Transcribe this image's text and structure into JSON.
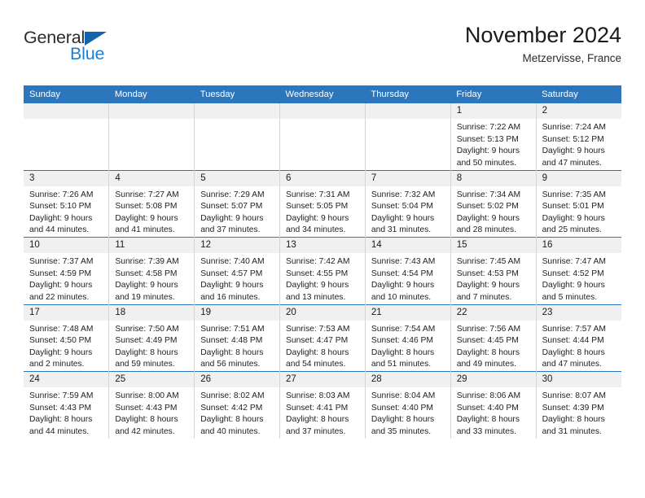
{
  "brand": {
    "name_part1": "General",
    "name_part2": "Blue",
    "triangle_icon": "triangle-icon",
    "accent_color": "#1d7fd4",
    "triangle_color": "#1464ad"
  },
  "header": {
    "title": "November 2024",
    "subtitle": "Metzervisse, France"
  },
  "theme": {
    "header_bg": "#2c76bd",
    "daynum_bg": "#f0f0f0",
    "cell_border": "#d4d4d4",
    "row_border": "#2c76bd"
  },
  "weekdays": [
    "Sunday",
    "Monday",
    "Tuesday",
    "Wednesday",
    "Thursday",
    "Friday",
    "Saturday"
  ],
  "weeks": [
    [
      {
        "day": "",
        "sunrise": "",
        "sunset": "",
        "daylight_line1": "",
        "daylight_line2": ""
      },
      {
        "day": "",
        "sunrise": "",
        "sunset": "",
        "daylight_line1": "",
        "daylight_line2": ""
      },
      {
        "day": "",
        "sunrise": "",
        "sunset": "",
        "daylight_line1": "",
        "daylight_line2": ""
      },
      {
        "day": "",
        "sunrise": "",
        "sunset": "",
        "daylight_line1": "",
        "daylight_line2": ""
      },
      {
        "day": "",
        "sunrise": "",
        "sunset": "",
        "daylight_line1": "",
        "daylight_line2": ""
      },
      {
        "day": "1",
        "sunrise": "Sunrise: 7:22 AM",
        "sunset": "Sunset: 5:13 PM",
        "daylight_line1": "Daylight: 9 hours",
        "daylight_line2": "and 50 minutes."
      },
      {
        "day": "2",
        "sunrise": "Sunrise: 7:24 AM",
        "sunset": "Sunset: 5:12 PM",
        "daylight_line1": "Daylight: 9 hours",
        "daylight_line2": "and 47 minutes."
      }
    ],
    [
      {
        "day": "3",
        "sunrise": "Sunrise: 7:26 AM",
        "sunset": "Sunset: 5:10 PM",
        "daylight_line1": "Daylight: 9 hours",
        "daylight_line2": "and 44 minutes."
      },
      {
        "day": "4",
        "sunrise": "Sunrise: 7:27 AM",
        "sunset": "Sunset: 5:08 PM",
        "daylight_line1": "Daylight: 9 hours",
        "daylight_line2": "and 41 minutes."
      },
      {
        "day": "5",
        "sunrise": "Sunrise: 7:29 AM",
        "sunset": "Sunset: 5:07 PM",
        "daylight_line1": "Daylight: 9 hours",
        "daylight_line2": "and 37 minutes."
      },
      {
        "day": "6",
        "sunrise": "Sunrise: 7:31 AM",
        "sunset": "Sunset: 5:05 PM",
        "daylight_line1": "Daylight: 9 hours",
        "daylight_line2": "and 34 minutes."
      },
      {
        "day": "7",
        "sunrise": "Sunrise: 7:32 AM",
        "sunset": "Sunset: 5:04 PM",
        "daylight_line1": "Daylight: 9 hours",
        "daylight_line2": "and 31 minutes."
      },
      {
        "day": "8",
        "sunrise": "Sunrise: 7:34 AM",
        "sunset": "Sunset: 5:02 PM",
        "daylight_line1": "Daylight: 9 hours",
        "daylight_line2": "and 28 minutes."
      },
      {
        "day": "9",
        "sunrise": "Sunrise: 7:35 AM",
        "sunset": "Sunset: 5:01 PM",
        "daylight_line1": "Daylight: 9 hours",
        "daylight_line2": "and 25 minutes."
      }
    ],
    [
      {
        "day": "10",
        "sunrise": "Sunrise: 7:37 AM",
        "sunset": "Sunset: 4:59 PM",
        "daylight_line1": "Daylight: 9 hours",
        "daylight_line2": "and 22 minutes."
      },
      {
        "day": "11",
        "sunrise": "Sunrise: 7:39 AM",
        "sunset": "Sunset: 4:58 PM",
        "daylight_line1": "Daylight: 9 hours",
        "daylight_line2": "and 19 minutes."
      },
      {
        "day": "12",
        "sunrise": "Sunrise: 7:40 AM",
        "sunset": "Sunset: 4:57 PM",
        "daylight_line1": "Daylight: 9 hours",
        "daylight_line2": "and 16 minutes."
      },
      {
        "day": "13",
        "sunrise": "Sunrise: 7:42 AM",
        "sunset": "Sunset: 4:55 PM",
        "daylight_line1": "Daylight: 9 hours",
        "daylight_line2": "and 13 minutes."
      },
      {
        "day": "14",
        "sunrise": "Sunrise: 7:43 AM",
        "sunset": "Sunset: 4:54 PM",
        "daylight_line1": "Daylight: 9 hours",
        "daylight_line2": "and 10 minutes."
      },
      {
        "day": "15",
        "sunrise": "Sunrise: 7:45 AM",
        "sunset": "Sunset: 4:53 PM",
        "daylight_line1": "Daylight: 9 hours",
        "daylight_line2": "and 7 minutes."
      },
      {
        "day": "16",
        "sunrise": "Sunrise: 7:47 AM",
        "sunset": "Sunset: 4:52 PM",
        "daylight_line1": "Daylight: 9 hours",
        "daylight_line2": "and 5 minutes."
      }
    ],
    [
      {
        "day": "17",
        "sunrise": "Sunrise: 7:48 AM",
        "sunset": "Sunset: 4:50 PM",
        "daylight_line1": "Daylight: 9 hours",
        "daylight_line2": "and 2 minutes."
      },
      {
        "day": "18",
        "sunrise": "Sunrise: 7:50 AM",
        "sunset": "Sunset: 4:49 PM",
        "daylight_line1": "Daylight: 8 hours",
        "daylight_line2": "and 59 minutes."
      },
      {
        "day": "19",
        "sunrise": "Sunrise: 7:51 AM",
        "sunset": "Sunset: 4:48 PM",
        "daylight_line1": "Daylight: 8 hours",
        "daylight_line2": "and 56 minutes."
      },
      {
        "day": "20",
        "sunrise": "Sunrise: 7:53 AM",
        "sunset": "Sunset: 4:47 PM",
        "daylight_line1": "Daylight: 8 hours",
        "daylight_line2": "and 54 minutes."
      },
      {
        "day": "21",
        "sunrise": "Sunrise: 7:54 AM",
        "sunset": "Sunset: 4:46 PM",
        "daylight_line1": "Daylight: 8 hours",
        "daylight_line2": "and 51 minutes."
      },
      {
        "day": "22",
        "sunrise": "Sunrise: 7:56 AM",
        "sunset": "Sunset: 4:45 PM",
        "daylight_line1": "Daylight: 8 hours",
        "daylight_line2": "and 49 minutes."
      },
      {
        "day": "23",
        "sunrise": "Sunrise: 7:57 AM",
        "sunset": "Sunset: 4:44 PM",
        "daylight_line1": "Daylight: 8 hours",
        "daylight_line2": "and 47 minutes."
      }
    ],
    [
      {
        "day": "24",
        "sunrise": "Sunrise: 7:59 AM",
        "sunset": "Sunset: 4:43 PM",
        "daylight_line1": "Daylight: 8 hours",
        "daylight_line2": "and 44 minutes."
      },
      {
        "day": "25",
        "sunrise": "Sunrise: 8:00 AM",
        "sunset": "Sunset: 4:43 PM",
        "daylight_line1": "Daylight: 8 hours",
        "daylight_line2": "and 42 minutes."
      },
      {
        "day": "26",
        "sunrise": "Sunrise: 8:02 AM",
        "sunset": "Sunset: 4:42 PM",
        "daylight_line1": "Daylight: 8 hours",
        "daylight_line2": "and 40 minutes."
      },
      {
        "day": "27",
        "sunrise": "Sunrise: 8:03 AM",
        "sunset": "Sunset: 4:41 PM",
        "daylight_line1": "Daylight: 8 hours",
        "daylight_line2": "and 37 minutes."
      },
      {
        "day": "28",
        "sunrise": "Sunrise: 8:04 AM",
        "sunset": "Sunset: 4:40 PM",
        "daylight_line1": "Daylight: 8 hours",
        "daylight_line2": "and 35 minutes."
      },
      {
        "day": "29",
        "sunrise": "Sunrise: 8:06 AM",
        "sunset": "Sunset: 4:40 PM",
        "daylight_line1": "Daylight: 8 hours",
        "daylight_line2": "and 33 minutes."
      },
      {
        "day": "30",
        "sunrise": "Sunrise: 8:07 AM",
        "sunset": "Sunset: 4:39 PM",
        "daylight_line1": "Daylight: 8 hours",
        "daylight_line2": "and 31 minutes."
      }
    ]
  ]
}
